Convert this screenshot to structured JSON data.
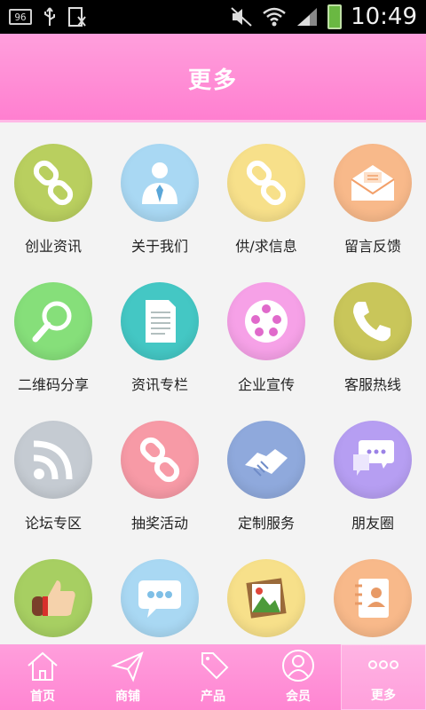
{
  "status_bar": {
    "badge": "96",
    "time": "10:49"
  },
  "header": {
    "title": "更多"
  },
  "tiles": [
    {
      "label": "创业资讯",
      "icon": "chain-link-icon",
      "color": "#b9cf5f"
    },
    {
      "label": "关于我们",
      "icon": "person-suit-icon",
      "color": "#a9d8f3"
    },
    {
      "label": "供/求信息",
      "icon": "chain-link-icon",
      "color": "#f7e08a"
    },
    {
      "label": "留言反馈",
      "icon": "envelope-icon",
      "color": "#f8b98a"
    },
    {
      "label": "二维码分享",
      "icon": "magnifier-icon",
      "color": "#86df7a"
    },
    {
      "label": "资讯专栏",
      "icon": "document-icon",
      "color": "#44c7c4"
    },
    {
      "label": "企业宣传",
      "icon": "film-reel-icon",
      "color": "#f6a1e7"
    },
    {
      "label": "客服热线",
      "icon": "phone-icon",
      "color": "#c9c65a"
    },
    {
      "label": "论坛专区",
      "icon": "rss-icon",
      "color": "#c5cbd2"
    },
    {
      "label": "抽奖活动",
      "icon": "chain-link-icon",
      "color": "#f79aa6"
    },
    {
      "label": "定制服务",
      "icon": "handshake-icon",
      "color": "#8fa9dc"
    },
    {
      "label": "朋友圈",
      "icon": "chat-bubbles-icon",
      "color": "#b69ef2"
    },
    {
      "label": "",
      "icon": "thumbs-up-icon",
      "color": "#a7cf62"
    },
    {
      "label": "",
      "icon": "speech-bubble-icon",
      "color": "#a9d8f3"
    },
    {
      "label": "",
      "icon": "picture-icon",
      "color": "#f7e08a"
    },
    {
      "label": "",
      "icon": "contact-book-icon",
      "color": "#f8b98a"
    }
  ],
  "bottom_nav": [
    {
      "label": "首页",
      "icon": "home-icon"
    },
    {
      "label": "商铺",
      "icon": "paper-plane-icon"
    },
    {
      "label": "产品",
      "icon": "sale-tag-icon"
    },
    {
      "label": "会员",
      "icon": "user-icon"
    },
    {
      "label": "更多",
      "icon": "more-dots-icon",
      "active": true
    }
  ]
}
